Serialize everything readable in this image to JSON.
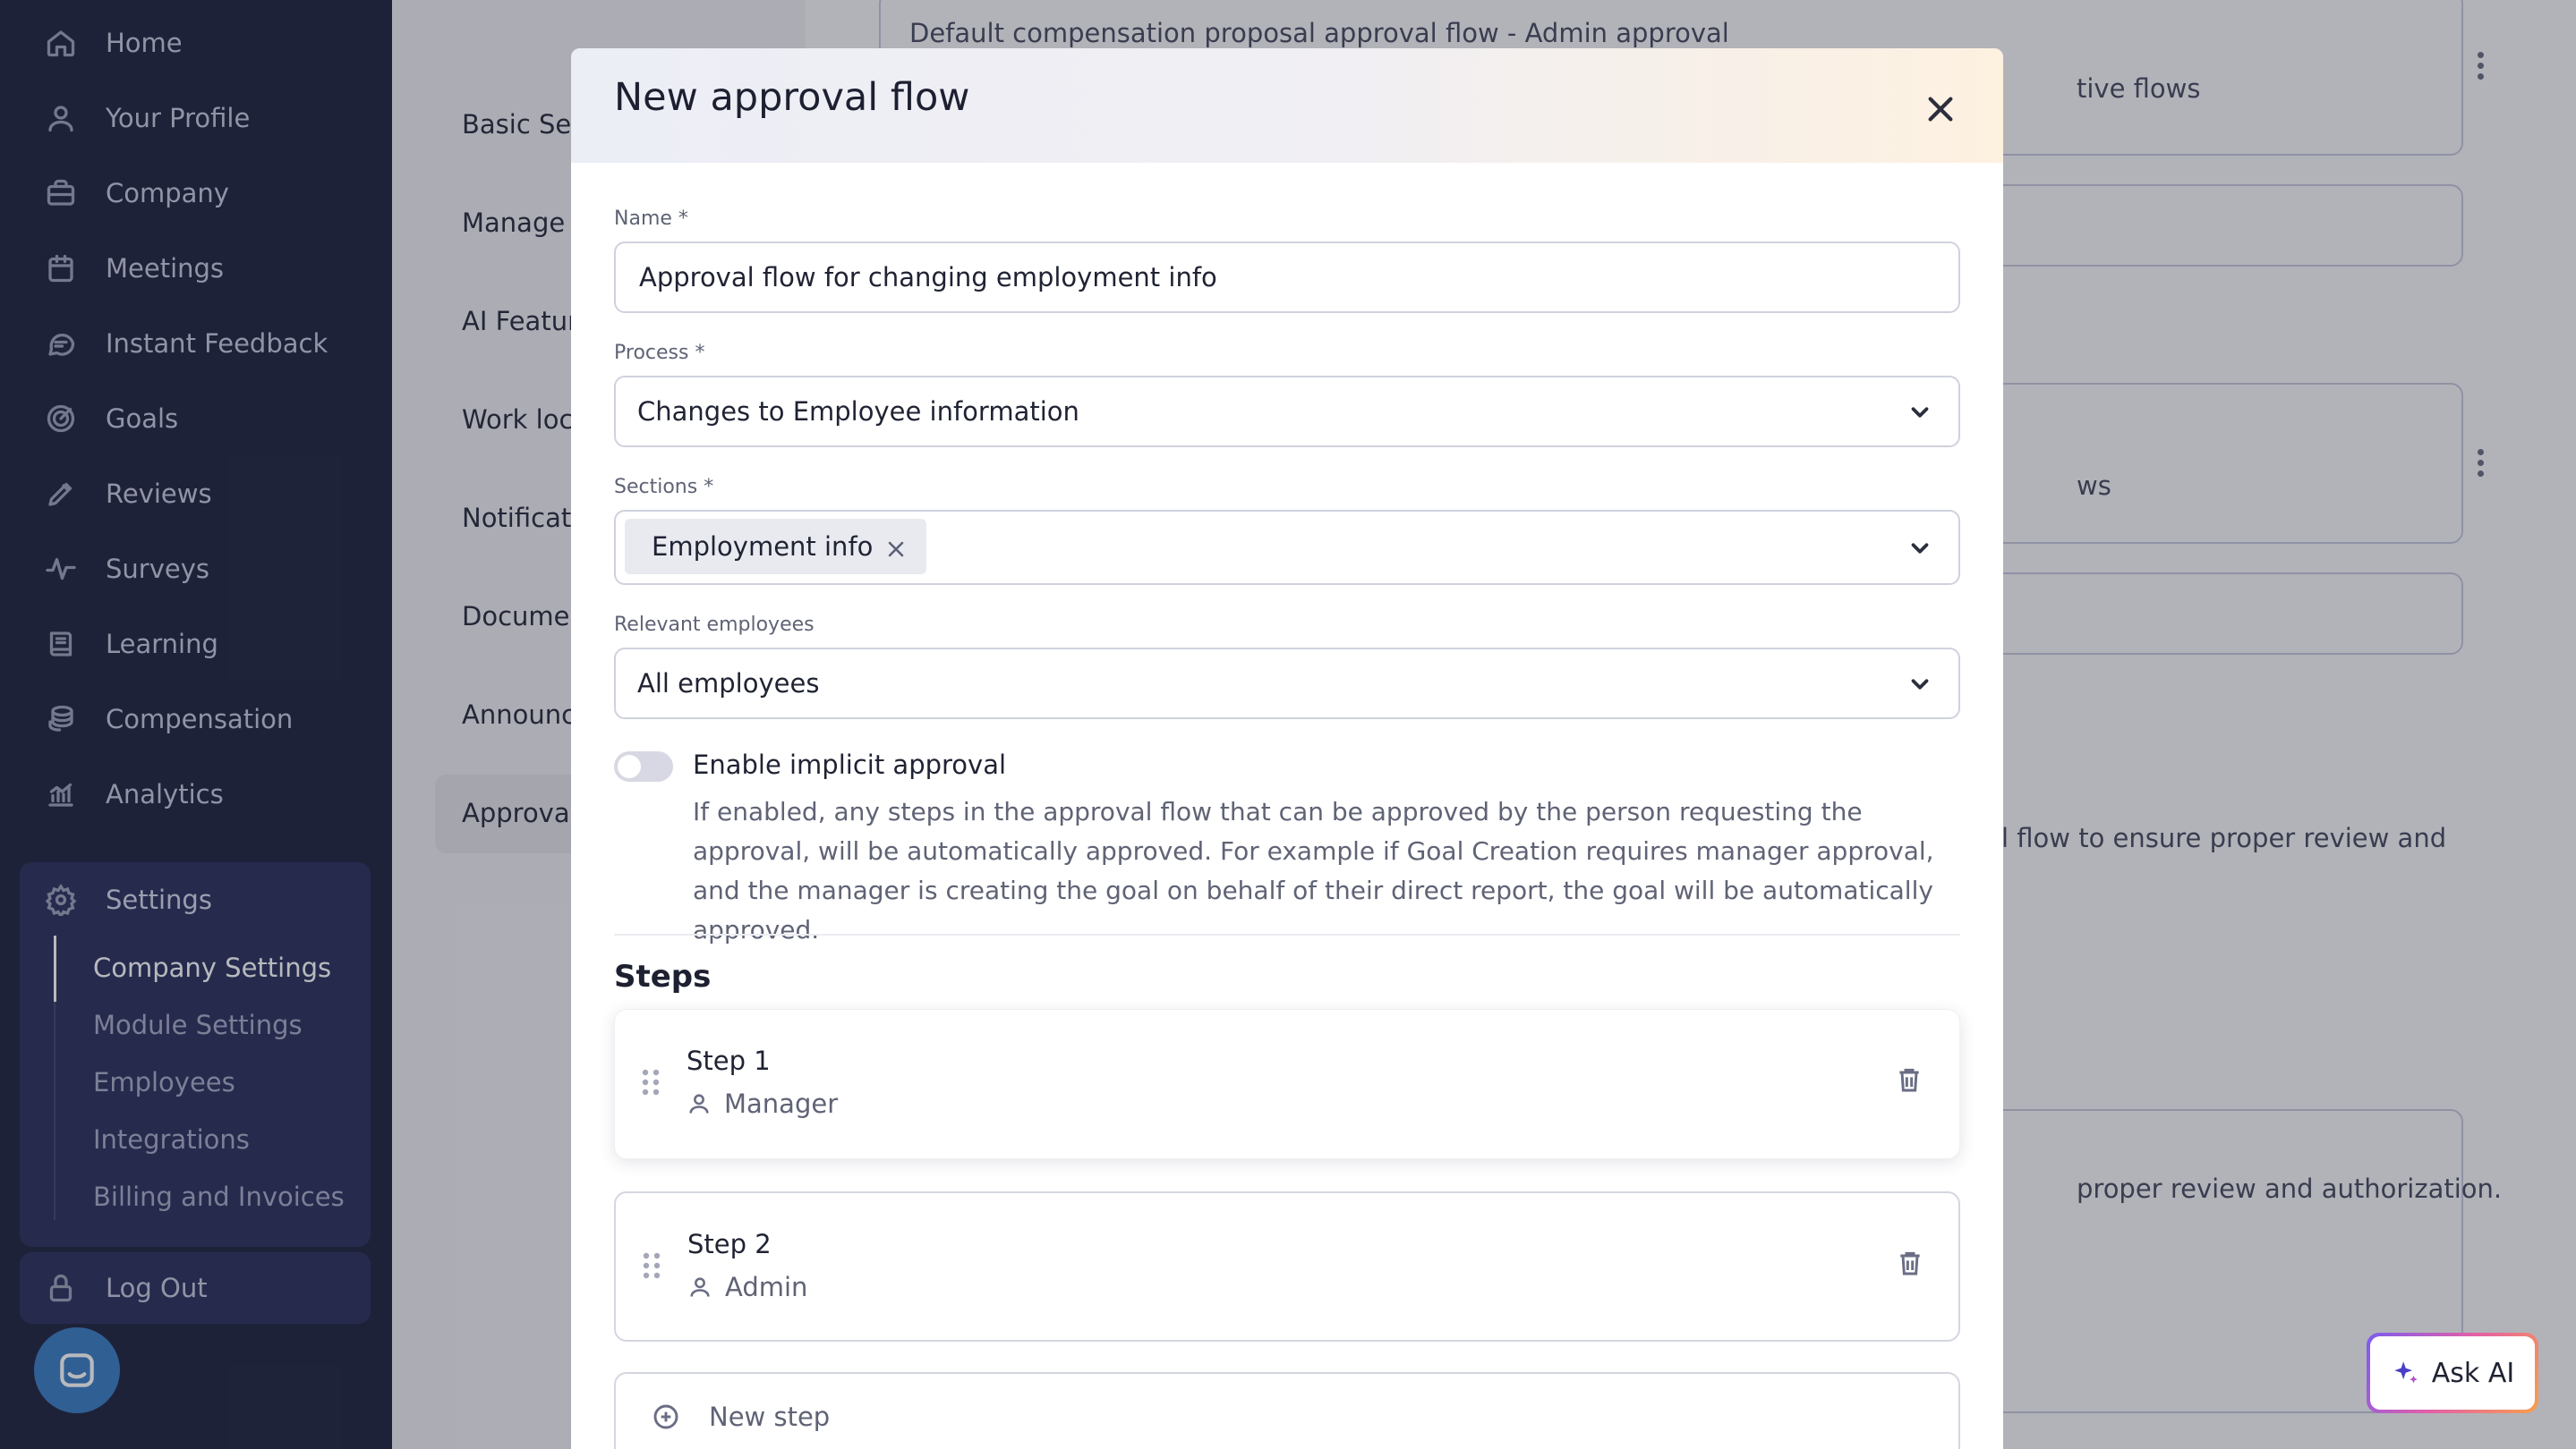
{
  "sidebar": {
    "items": [
      {
        "label": "Home",
        "icon": "home-icon"
      },
      {
        "label": "Your Profile",
        "icon": "user-icon"
      },
      {
        "label": "Company",
        "icon": "briefcase-icon"
      },
      {
        "label": "Meetings",
        "icon": "calendar-icon"
      },
      {
        "label": "Instant Feedback",
        "icon": "chat-icon"
      },
      {
        "label": "Goals",
        "icon": "target-icon"
      },
      {
        "label": "Reviews",
        "icon": "pencil-icon"
      },
      {
        "label": "Surveys",
        "icon": "pulse-icon"
      },
      {
        "label": "Learning",
        "icon": "book-icon"
      },
      {
        "label": "Compensation",
        "icon": "coins-icon"
      },
      {
        "label": "Analytics",
        "icon": "chart-icon"
      }
    ],
    "settings": {
      "label": "Settings",
      "subitems": [
        "Company Settings",
        "Module Settings",
        "Employees",
        "Integrations",
        "Billing and Invoices"
      ]
    },
    "logout": "Log Out"
  },
  "settings_nav": {
    "tabs": [
      "Basic Settings",
      "Manage Modules",
      "AI Features",
      "Work locations",
      "Notifications",
      "Documents",
      "Announcements",
      "Approval flows"
    ]
  },
  "background": {
    "card1_title": "Default compensation proposal approval flow - Admin approval",
    "card1_sub": "tive flows",
    "card2_sub": "ws",
    "desc1": "l flow to ensure proper review and",
    "desc2": "proper review and authorization."
  },
  "modal": {
    "title": "New approval flow",
    "name_label": "Name *",
    "name_value": "Approval flow for changing employment info",
    "process_label": "Process *",
    "process_value": "Changes to Employee information",
    "sections_label": "Sections *",
    "sections_chip": "Employment info",
    "relevant_label": "Relevant employees",
    "relevant_value": "All employees",
    "implicit_label": "Enable implicit approval",
    "implicit_enabled": false,
    "implicit_desc": "If enabled, any steps in the approval flow that can be approved by the person requesting the approval, will be automatically approved. For example if Goal Creation requires manager approval, and the manager is creating the goal on behalf of their direct report, the goal will be automatically approved.",
    "steps_title": "Steps",
    "steps": [
      {
        "name": "Step 1",
        "role": "Manager"
      },
      {
        "name": "Step 2",
        "role": "Admin"
      }
    ],
    "new_step": "New step"
  },
  "ask_ai": "Ask AI",
  "colors": {
    "sidebar_bg": "#232842",
    "settings_box": "#2e3461",
    "chat_bubble": "#3d7fc4"
  }
}
